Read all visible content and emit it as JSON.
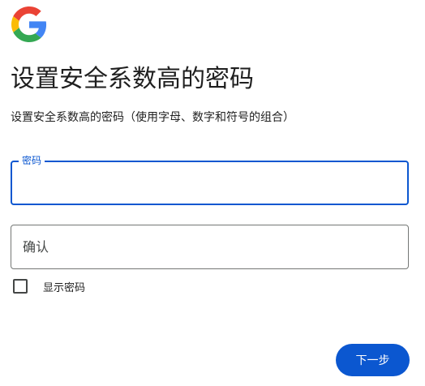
{
  "header": {
    "logo_icon": "google-g-logo",
    "title": "设置安全系数高的密码",
    "subtitle": "设置安全系数高的密码（使用字母、数字和符号的组合）"
  },
  "form": {
    "password": {
      "label": "密码",
      "value": "",
      "type": "password"
    },
    "confirm": {
      "placeholder": "确认",
      "value": "",
      "type": "password"
    },
    "show_password": {
      "label": "显示密码",
      "checked": false
    }
  },
  "actions": {
    "next_label": "下一步"
  },
  "colors": {
    "accent": "#0b57d0",
    "text": "#1f1f1f",
    "border": "#747775",
    "google_blue": "#4285F4",
    "google_red": "#EA4335",
    "google_yellow": "#FBBC05",
    "google_green": "#34A853"
  }
}
